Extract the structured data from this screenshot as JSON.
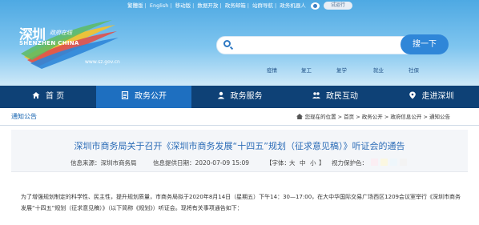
{
  "topbar": {
    "links": [
      "繁體版",
      "English",
      "移动版",
      "数据开放",
      "政务邮箱",
      "站群导航",
      "政务机器人"
    ],
    "old_version_button": "试运行"
  },
  "logo": {
    "title_cn": "深圳",
    "subtitle_cn": "政府在线",
    "title_en": "SHENZHEN CHINA",
    "url": "www.sz.gov.cn"
  },
  "search": {
    "placeholder": "",
    "button_label": "搜一下"
  },
  "hot_keywords": [
    "疫情",
    "复工",
    "复学",
    "就业",
    "社保"
  ],
  "nav": {
    "items": [
      {
        "label": "首 页",
        "icon": "home-icon"
      },
      {
        "label": "政务公开",
        "icon": "document-icon"
      },
      {
        "label": "政务服务",
        "icon": "user-service-icon"
      },
      {
        "label": "政民互动",
        "icon": "people-icon"
      },
      {
        "label": "走进深圳",
        "icon": "location-pin-icon"
      }
    ],
    "active_index": 1,
    "colors": {
      "bar": "#0e4176",
      "active": "#1e6fc0"
    }
  },
  "breadcrumb": {
    "section_title": "通知公告",
    "prefix": "您现在的位置",
    "items": [
      "首页",
      "政务公开",
      "政府信息公开",
      "通知公告"
    ],
    "separator": ">"
  },
  "article": {
    "title": "深圳市商务局关于召开《深圳市商务发展“十四五”规划（征求意见稿）》听证会的通告",
    "source": "信息来源：深圳市商务局",
    "date": "信息提供日期：2020-07-09 15:09",
    "font_size_label": "【字体：",
    "font_sizes": [
      "大",
      "中",
      "小"
    ],
    "font_size_close": "】",
    "eye_protection": "视力保护色：",
    "eye_colors": [
      "#fbeef3",
      "#fbf7e1",
      "#eef6fb",
      "#f3f3f3"
    ],
    "paragraph1": "为了增强规划制定的科学性、民主性，提升规划质量，市商务局拟于2020年8月14日（星期五）下午14：30—17:00，在大中华国际交易广场西区1209会议室举行《深圳市商务",
    "paragraph2": "发展“十四五”规划（征求意见稿）》（以下简称《规划》）听证会。现将有关事项通告如下："
  }
}
